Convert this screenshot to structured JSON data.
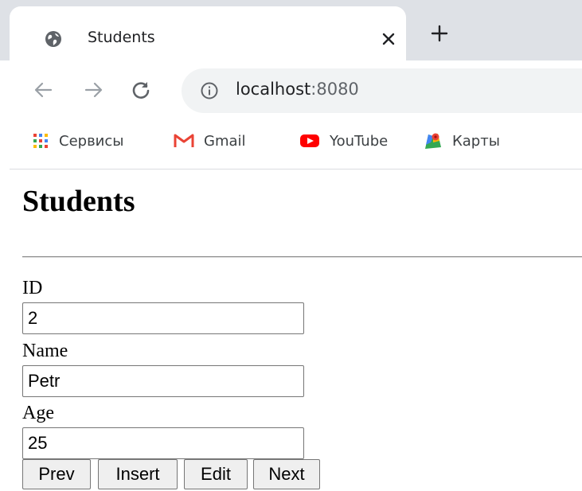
{
  "browser": {
    "tab": {
      "title": "Students",
      "close_label": "×",
      "new_tab_label": "+"
    },
    "address": {
      "host": "localhost",
      "port": ":8080"
    },
    "bookmarks": [
      {
        "label": "Сервисы",
        "icon": "apps-grid-icon"
      },
      {
        "label": "Gmail",
        "icon": "gmail-icon"
      },
      {
        "label": "YouTube",
        "icon": "youtube-icon"
      },
      {
        "label": "Карты",
        "icon": "maps-icon"
      }
    ],
    "colors": {
      "tabstrip": "#dee1e6",
      "omnibox": "#f1f3f4",
      "gmail_red": "#ea4335",
      "youtube_red": "#ff0000"
    }
  },
  "page": {
    "title": "Students",
    "fields": [
      {
        "label": "ID",
        "value": "2"
      },
      {
        "label": "Name",
        "value": "Petr"
      },
      {
        "label": "Age",
        "value": "25"
      }
    ],
    "buttons": {
      "prev": "Prev",
      "insert": "Insert",
      "edit": "Edit",
      "next": "Next"
    }
  }
}
